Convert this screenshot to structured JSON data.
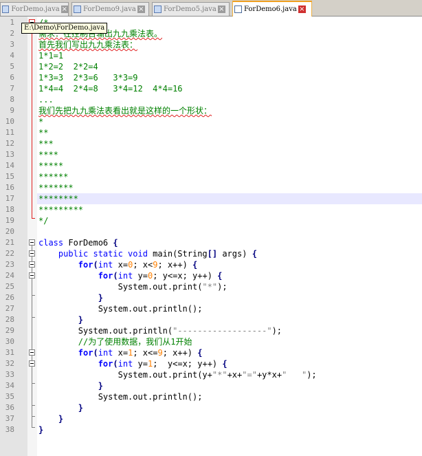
{
  "tabs": [
    {
      "label": "ForDemo.java",
      "active": false
    },
    {
      "label": "ForDemo9.java",
      "active": false
    },
    {
      "label": "ForDemo5.java",
      "active": false
    },
    {
      "label": "ForDemo6.java",
      "active": true
    }
  ],
  "tooltip": "E:\\Demo\\ForDemo.java",
  "current_line": 17,
  "lines": [
    {
      "n": "1",
      "tokens": [
        {
          "t": "/*",
          "c": "cmt"
        }
      ]
    },
    {
      "n": "2",
      "tokens": [
        {
          "t": "需求：在控制台输出九九乘法表。",
          "c": "cmt squig"
        }
      ]
    },
    {
      "n": "3",
      "tokens": [
        {
          "t": "首先我们写出九九乘法表：",
          "c": "cmt squig"
        }
      ]
    },
    {
      "n": "4",
      "tokens": [
        {
          "t": "1*1=1",
          "c": "cmt"
        }
      ]
    },
    {
      "n": "5",
      "tokens": [
        {
          "t": "1*2=2  2*2=4",
          "c": "cmt"
        }
      ]
    },
    {
      "n": "6",
      "tokens": [
        {
          "t": "1*3=3  2*3=6   3*3=9",
          "c": "cmt"
        }
      ]
    },
    {
      "n": "7",
      "tokens": [
        {
          "t": "1*4=4  2*4=8   3*4=12  4*4=16",
          "c": "cmt"
        }
      ]
    },
    {
      "n": "8",
      "tokens": [
        {
          "t": "...",
          "c": "cmt"
        }
      ]
    },
    {
      "n": "9",
      "tokens": [
        {
          "t": "我们先把九九乘法表看出就是这样的一个形状：",
          "c": "cmt squig"
        }
      ]
    },
    {
      "n": "10",
      "tokens": [
        {
          "t": "*",
          "c": "cmt"
        }
      ]
    },
    {
      "n": "11",
      "tokens": [
        {
          "t": "**",
          "c": "cmt"
        }
      ]
    },
    {
      "n": "12",
      "tokens": [
        {
          "t": "***",
          "c": "cmt"
        }
      ]
    },
    {
      "n": "13",
      "tokens": [
        {
          "t": "****",
          "c": "cmt"
        }
      ]
    },
    {
      "n": "14",
      "tokens": [
        {
          "t": "*****",
          "c": "cmt"
        }
      ]
    },
    {
      "n": "15",
      "tokens": [
        {
          "t": "******",
          "c": "cmt"
        }
      ]
    },
    {
      "n": "16",
      "tokens": [
        {
          "t": "*******",
          "c": "cmt"
        }
      ]
    },
    {
      "n": "17",
      "tokens": [
        {
          "t": "********",
          "c": "cmt"
        }
      ]
    },
    {
      "n": "18",
      "tokens": [
        {
          "t": "*********",
          "c": "cmt"
        }
      ]
    },
    {
      "n": "19",
      "tokens": [
        {
          "t": "*/",
          "c": "cmt"
        }
      ]
    },
    {
      "n": "20",
      "tokens": []
    },
    {
      "n": "21",
      "tokens": [
        {
          "t": "class",
          "c": "tok-kw"
        },
        {
          "t": " ForDemo6 ",
          "c": "tok-plain"
        },
        {
          "t": "{",
          "c": "tok-op"
        }
      ]
    },
    {
      "n": "22",
      "tokens": [
        {
          "t": "    public static void",
          "c": "tok-kw"
        },
        {
          "t": " main(String",
          "c": "tok-plain"
        },
        {
          "t": "[]",
          "c": "tok-op"
        },
        {
          "t": " args) ",
          "c": "tok-plain"
        },
        {
          "t": "{",
          "c": "tok-op"
        }
      ]
    },
    {
      "n": "23",
      "tokens": [
        {
          "t": "        ",
          "c": "tok-plain"
        },
        {
          "t": "for",
          "c": "tok-kb"
        },
        {
          "t": "(",
          "c": "tok-op"
        },
        {
          "t": "int",
          "c": "tok-kw"
        },
        {
          "t": " x=",
          "c": "tok-plain"
        },
        {
          "t": "0",
          "c": "tok-num"
        },
        {
          "t": "; x<",
          "c": "tok-plain"
        },
        {
          "t": "9",
          "c": "tok-num"
        },
        {
          "t": "; x++) ",
          "c": "tok-plain"
        },
        {
          "t": "{",
          "c": "tok-op"
        }
      ]
    },
    {
      "n": "24",
      "tokens": [
        {
          "t": "            ",
          "c": "tok-plain"
        },
        {
          "t": "for",
          "c": "tok-kb"
        },
        {
          "t": "(",
          "c": "tok-op"
        },
        {
          "t": "int",
          "c": "tok-kw"
        },
        {
          "t": " y=",
          "c": "tok-plain"
        },
        {
          "t": "0",
          "c": "tok-num"
        },
        {
          "t": "; y<=x; y++) ",
          "c": "tok-plain"
        },
        {
          "t": "{",
          "c": "tok-op"
        }
      ]
    },
    {
      "n": "25",
      "tokens": [
        {
          "t": "                System.out.print(",
          "c": "tok-plain"
        },
        {
          "t": "\"*\"",
          "c": "tok-str"
        },
        {
          "t": ");",
          "c": "tok-plain"
        }
      ]
    },
    {
      "n": "26",
      "tokens": [
        {
          "t": "            ",
          "c": "tok-plain"
        },
        {
          "t": "}",
          "c": "tok-op"
        }
      ]
    },
    {
      "n": "27",
      "tokens": [
        {
          "t": "            System.out.println();",
          "c": "tok-plain"
        }
      ]
    },
    {
      "n": "28",
      "tokens": [
        {
          "t": "        ",
          "c": "tok-plain"
        },
        {
          "t": "}",
          "c": "tok-op"
        }
      ]
    },
    {
      "n": "29",
      "tokens": [
        {
          "t": "        System.out.println(",
          "c": "tok-plain"
        },
        {
          "t": "\"------------------\"",
          "c": "tok-str"
        },
        {
          "t": ");",
          "c": "tok-plain"
        }
      ]
    },
    {
      "n": "30",
      "tokens": [
        {
          "t": "        //为了使用数据，我们从1开始",
          "c": "cmt"
        }
      ]
    },
    {
      "n": "31",
      "tokens": [
        {
          "t": "        ",
          "c": "tok-plain"
        },
        {
          "t": "for",
          "c": "tok-kb"
        },
        {
          "t": "(",
          "c": "tok-op"
        },
        {
          "t": "int",
          "c": "tok-kw"
        },
        {
          "t": " x=",
          "c": "tok-plain"
        },
        {
          "t": "1",
          "c": "tok-num"
        },
        {
          "t": "; x<=",
          "c": "tok-plain"
        },
        {
          "t": "9",
          "c": "tok-num"
        },
        {
          "t": "; x++) ",
          "c": "tok-plain"
        },
        {
          "t": "{",
          "c": "tok-op"
        }
      ]
    },
    {
      "n": "32",
      "tokens": [
        {
          "t": "            ",
          "c": "tok-plain"
        },
        {
          "t": "for",
          "c": "tok-kb"
        },
        {
          "t": "(",
          "c": "tok-op"
        },
        {
          "t": "int",
          "c": "tok-kw"
        },
        {
          "t": " y=",
          "c": "tok-plain"
        },
        {
          "t": "1",
          "c": "tok-num"
        },
        {
          "t": ";  y<=x; y++) ",
          "c": "tok-plain"
        },
        {
          "t": "{",
          "c": "tok-op"
        }
      ]
    },
    {
      "n": "33",
      "tokens": [
        {
          "t": "                System.out.print(y+",
          "c": "tok-plain"
        },
        {
          "t": "\"*\"",
          "c": "tok-str"
        },
        {
          "t": "+x+",
          "c": "tok-plain"
        },
        {
          "t": "\"=\"",
          "c": "tok-str"
        },
        {
          "t": "+y*x+",
          "c": "tok-plain"
        },
        {
          "t": "\"   \"",
          "c": "tok-str"
        },
        {
          "t": ");",
          "c": "tok-plain"
        }
      ]
    },
    {
      "n": "34",
      "tokens": [
        {
          "t": "            ",
          "c": "tok-plain"
        },
        {
          "t": "}",
          "c": "tok-op"
        }
      ]
    },
    {
      "n": "35",
      "tokens": [
        {
          "t": "            System.out.println();",
          "c": "tok-plain"
        }
      ]
    },
    {
      "n": "36",
      "tokens": [
        {
          "t": "        ",
          "c": "tok-plain"
        },
        {
          "t": "}",
          "c": "tok-op"
        }
      ]
    },
    {
      "n": "37",
      "tokens": [
        {
          "t": "    ",
          "c": "tok-plain"
        },
        {
          "t": "}",
          "c": "tok-op"
        }
      ]
    },
    {
      "n": "38",
      "tokens": [
        {
          "t": "}",
          "c": "tok-op"
        }
      ]
    }
  ]
}
